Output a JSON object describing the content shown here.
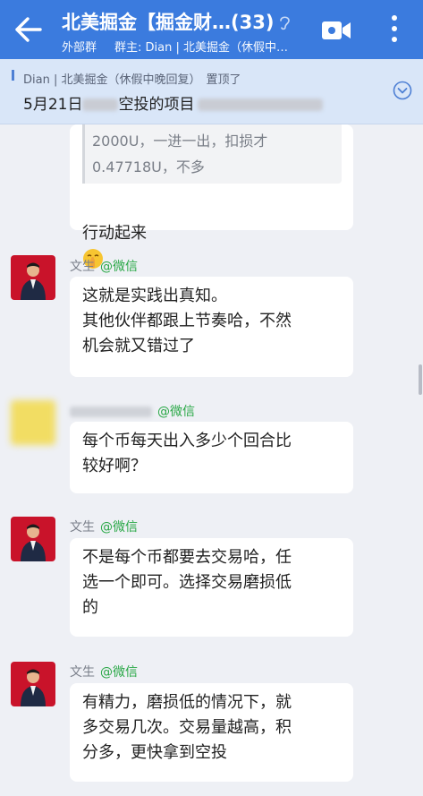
{
  "header": {
    "title": "北美掘金【掘金财…",
    "member_count": "(33)",
    "external_tag": "外部群",
    "owner": "群主: Dian | 北美掘金（休假中…",
    "bg_color": "#3b7bde"
  },
  "pinned": {
    "author": "Dian | 北美掘金（休假中晚回复）",
    "label": "置顶了",
    "text_prefix": "5月21日",
    "text_mid": "空投的项目",
    "accent": "#4d7fd4"
  },
  "messages": [
    {
      "quote": "2000U，一进一出，扣损才\n0.47718U，不多",
      "text": "行动起来",
      "emoji": "shush-face"
    },
    {
      "sender": "文生",
      "source": "@微信",
      "text": "这就是实践出真知。\n其他伙伴都跟上节奏哈，不然\n机会就又错过了"
    },
    {
      "sender": "",
      "source": "@微信",
      "text": "每个币每天出入多少个回合比\n较好啊？"
    },
    {
      "sender": "文生",
      "source": "@微信",
      "text": "不是每个币都要去交易哈，任\n选一个即可。选择交易磨损低\n的"
    },
    {
      "sender": "文生",
      "source": "@微信",
      "text": "有精力，磨损低的情况下，就\n多交易几次。交易量越高，积\n分多，更快拿到空投"
    }
  ]
}
